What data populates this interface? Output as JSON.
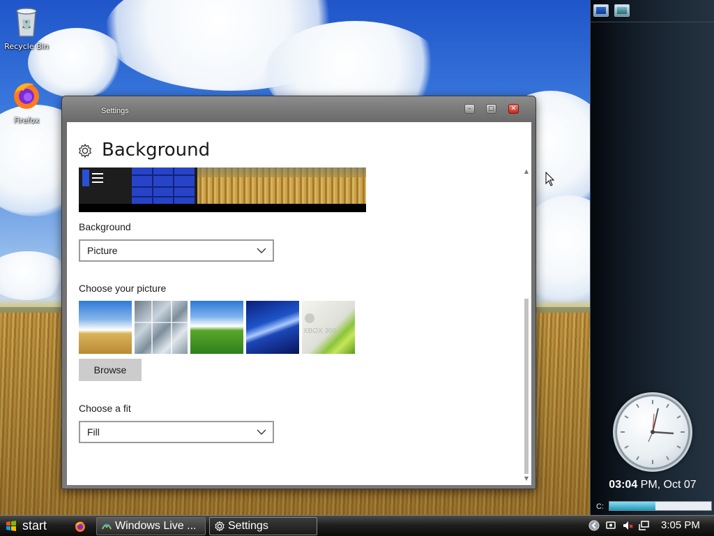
{
  "desktop": {
    "icons": [
      {
        "label": "Recycle Bin",
        "icon": "recycle-bin-icon"
      },
      {
        "label": "Firefox",
        "icon": "firefox-icon"
      }
    ]
  },
  "window": {
    "title": "Settings",
    "controls": {
      "minimize": "minimize-icon",
      "maximize": "maximize-icon",
      "close": "close-icon"
    },
    "page_title": "Background",
    "background_label": "Background",
    "background_value": "Picture",
    "picture_label": "Choose your picture",
    "pictures": [
      "wheat-field",
      "glass-building",
      "green-hills",
      "blue-abstract",
      "xbox-360"
    ],
    "xbox_text": "XBOX 360",
    "browse_label": "Browse",
    "fit_label": "Choose a fit",
    "fit_value": "Fill"
  },
  "sidebar": {
    "clock_time_bold": "03:04",
    "clock_time_rest": " PM, Oct 07",
    "drive_label": "C:",
    "drive_usage": 0.45
  },
  "taskbar": {
    "start_label": "start",
    "tasks": [
      {
        "label": "Windows Live ...",
        "icon": "windows-live-icon"
      },
      {
        "label": "Settings",
        "icon": "gear-icon"
      }
    ],
    "tray_time": "3:05 PM"
  },
  "colors": {
    "accent_tile": "#2744c8",
    "window_frame": "#7a7a7a",
    "taskbar": "#1f1f1f"
  }
}
